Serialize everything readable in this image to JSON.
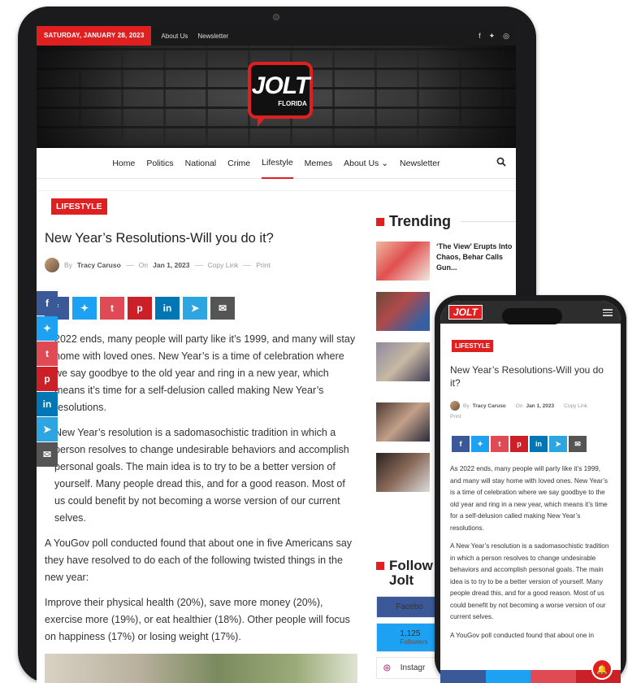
{
  "topbar": {
    "date": "SATURDAY, JANUARY 28, 2023",
    "links": [
      "About Us",
      "Newsletter"
    ],
    "social_icons": [
      "facebook-icon",
      "twitter-icon",
      "instagram-icon"
    ]
  },
  "logo": {
    "word": "JOLT",
    "sub": "FLORIDA"
  },
  "nav": {
    "items": [
      "Home",
      "Politics",
      "National",
      "Crime",
      "Lifestyle",
      "Memes",
      "About Us",
      "Newsletter"
    ],
    "active": "Lifestyle"
  },
  "article": {
    "category": "LIFESTYLE",
    "title": "New Year’s Resolutions-Will you do it?",
    "by": "By",
    "author": "Tracy Caruso",
    "on": "On",
    "date": "Jan 1, 2023",
    "copy_link": "Copy Link",
    "print": "Print",
    "paragraphs": [
      "2022 ends, many people will party like it’s 1999, and many will stay home with loved ones. New Year’s is a time of celebration where we say goodbye to the old year and ring in a new year, which means it’s time for a self-delusion called making New Year’s resolutions.",
      "New Year’s resolution is a sadomasochistic tradition in which a person resolves to change undesirable behaviors and accomplish personal goals. The main idea is to try to be a better version of yourself. Many people dread this, and for a good reason. Most of us could benefit by not becoming a worse version of our current selves.",
      "A YouGov poll conducted found that about one in five Americans say they have resolved to do each of the following twisted things in the new year:",
      "Improve their physical health (20%), save more money (20%), exercise more (19%), or eat healthier (18%). Other people will focus on happiness (17%) or losing weight (17%)."
    ]
  },
  "share_buttons": [
    "f",
    "t",
    "t",
    "p",
    "in",
    "tg",
    "mail"
  ],
  "trending": {
    "heading": "Trending",
    "items": [
      {
        "title": "‘The View’ Erupts Into Chaos, Behar Calls Gun..."
      },
      {
        "title": ""
      },
      {
        "title": ""
      },
      {
        "title": ""
      },
      {
        "title": ""
      }
    ]
  },
  "follow": {
    "heading": "Follow Jolt",
    "rows": [
      {
        "label": "Facebo"
      },
      {
        "count": "1,125",
        "label": "Followers"
      },
      {
        "label": "Instagr"
      }
    ]
  },
  "phone": {
    "logo": "JOLT",
    "category": "LIFESTYLE",
    "title": "New Year’s Resolutions-Will you do it?",
    "by": "By",
    "author": "Tracy Caruso",
    "on": "On",
    "date": "Jan 1, 2023",
    "copy_link": "Copy Link",
    "print": "Print",
    "paragraphs": [
      "As 2022 ends, many people will party like it’s 1999, and many will stay home with loved ones. New Year’s is a time of celebration where we say goodbye to the old year and ring in a new year, which means it’s time for a self-delusion called making New Year’s resolutions.",
      "A New Year’s resolution is a sadomasochistic tradition in which a person resolves to change undesirable behaviors and accomplish personal goals. The main idea is to try to be a better version of yourself. Many people dread this, and for a good reason. Most of us could benefit by not becoming a worse version of our current selves.",
      "A YouGov poll conducted found that about one in"
    ]
  },
  "colors": {
    "accent": "#e02020",
    "facebook": "#3b5998",
    "twitter": "#1da1f2",
    "pinterest": "#cb2027",
    "linkedin": "#0077b5",
    "telegram": "#2ca5e0"
  }
}
